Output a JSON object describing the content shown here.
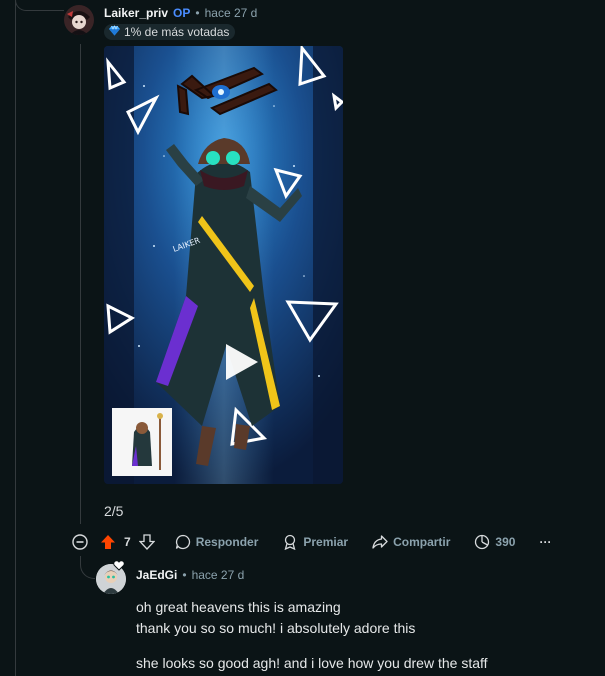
{
  "colors": {
    "background": "#0b1416",
    "op_blue": "#4a8dff",
    "upvote_active": "#ff4500",
    "muted_text": "#8ba2ad",
    "thread_line": "#343a3d"
  },
  "op_comment": {
    "author": "Laiker_priv",
    "op_badge": "OP",
    "separator": "•",
    "time": "hace 27 d",
    "flair_icon": "diamond-icon",
    "flair": "1% de más votadas",
    "media": {
      "kind": "video",
      "icon": "play-icon",
      "signature": "LAIKER"
    },
    "gallery_counter": "2/5",
    "actions": {
      "collapse_icon": "collapse-icon",
      "upvote_icon": "upvote-icon",
      "score": "7",
      "downvote_icon": "downvote-icon",
      "reply_label": "Responder",
      "award_label": "Premiar",
      "share_label": "Compartir",
      "views": "390",
      "more": "···"
    }
  },
  "reply_comment": {
    "author": "JaEdGi",
    "separator": "•",
    "time": "hace 27 d",
    "lines": [
      "oh great heavens this is amazing",
      "thank you so so much! i absolutely adore this",
      "she looks so good agh! and i love how you drew the staff"
    ]
  }
}
